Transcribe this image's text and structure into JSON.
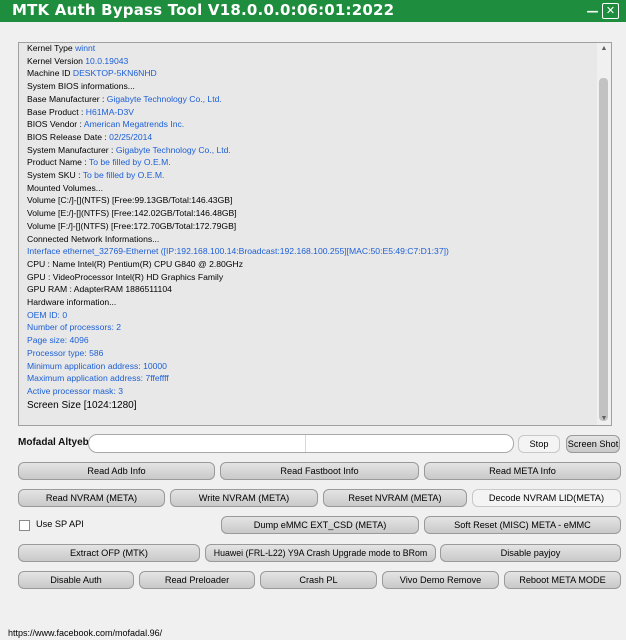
{
  "window": {
    "title": "MTK Auth Bypass Tool V18.0.0.0:06:01:2022",
    "minimize_glyph": "—",
    "close_glyph": "✕",
    "title_bar_color": "#1e8e3e"
  },
  "log": {
    "lines": [
      {
        "label": "Kernel Type ",
        "value": "winnt"
      },
      {
        "label": "Kernel Version ",
        "value": "10.0.19043"
      },
      {
        "label": "Machine ID ",
        "value": "DESKTOP-5KN6NHD"
      },
      {
        "label": "System BIOS informations...",
        "value": ""
      },
      {
        "label": "Base Manufacturer : ",
        "value": "Gigabyte Technology Co., Ltd."
      },
      {
        "label": "Base Product : ",
        "value": "H61MA-D3V"
      },
      {
        "label": "BIOS Vendor : ",
        "value": "American Megatrends Inc."
      },
      {
        "label": "BIOS Release Date : ",
        "value": "02/25/2014"
      },
      {
        "label": "System Manufacturer : ",
        "value": "Gigabyte Technology Co., Ltd."
      },
      {
        "label": "Product Name : ",
        "value": "To be filled by O.E.M."
      },
      {
        "label": "System SKU : ",
        "value": "To be filled by O.E.M."
      },
      {
        "label": "Mounted Volumes...",
        "value": ""
      },
      {
        "label": "Volume [C:/]-[](NTFS) [Free:99.13GB/Total:146.43GB]",
        "value": ""
      },
      {
        "label": "Volume [E:/]-[](NTFS) [Free:142.02GB/Total:146.48GB]",
        "value": ""
      },
      {
        "label": "Volume [F:/]-[](NTFS) [Free:172.70GB/Total:172.79GB]",
        "value": ""
      },
      {
        "label": "Connected Network Informations...",
        "value": ""
      },
      {
        "label": "",
        "value": "Interface ethernet_32769-Ethernet ([IP:192.168.100.14:Broadcast:192.168.100.255][MAC:50:E5:49:C7:D1:37])"
      },
      {
        "label": "CPU  : Name Intel(R) Pentium(R) CPU G840 @ 2.80GHz",
        "value": ""
      },
      {
        "label": "GPU  : VideoProcessor Intel(R) HD Graphics Family",
        "value": ""
      },
      {
        "label": "GPU RAM  : AdapterRAM 1886511104",
        "value": ""
      },
      {
        "label": "Hardware information...",
        "value": ""
      },
      {
        "label": "",
        "value": "OEM ID: 0"
      },
      {
        "label": "",
        "value": "Number of processors: 2"
      },
      {
        "label": "",
        "value": "Page size: 4096"
      },
      {
        "label": "",
        "value": "Processor type: 586"
      },
      {
        "label": "",
        "value": "Minimum application address: 10000"
      },
      {
        "label": "",
        "value": "Maximum application address: 7ffeffff"
      },
      {
        "label": "",
        "value": "Active processor mask: 3"
      }
    ],
    "screen_size": "Screen Size [1024:1280]",
    "value_color": "#1c5fd6"
  },
  "user": {
    "name_label": "Mofadal Altyeb",
    "input_value": ""
  },
  "buttons": {
    "stop": "Stop",
    "screen_shot": "Screen Shot",
    "read_adb_info": "Read Adb Info",
    "read_fastboot_info": "Read Fastboot Info",
    "read_meta_info": "Read META Info",
    "read_nvram_meta": "Read NVRAM (META)",
    "write_nvram_meta": "Write NVRAM (META)",
    "reset_nvram_meta": "Reset NVRAM (META)",
    "decode_nvram_lid": "Decode NVRAM LID(META)",
    "dump_emmc_ext_csd": "Dump eMMC EXT_CSD (META)",
    "soft_reset_misc": "Soft Reset (MISC) META - eMMC",
    "extract_ofp": "Extract OFP (MTK)",
    "huawei_crash_upgrade": "Huawei (FRL-L22) Y9A Crash Upgrade mode to BRom",
    "disable_payjoy": "Disable payjoy",
    "disable_auth": "Disable Auth",
    "read_preloader": "Read Preloader",
    "crash_pl": "Crash PL",
    "vivo_demo_remove": "Vivo Demo Remove",
    "reboot_meta_mode": "Reboot META MODE"
  },
  "options": {
    "use_sp_api_label": "Use SP API",
    "use_sp_api_checked": false
  },
  "footer": {
    "link_text": "https://www.facebook.com/mofadal.96/"
  }
}
